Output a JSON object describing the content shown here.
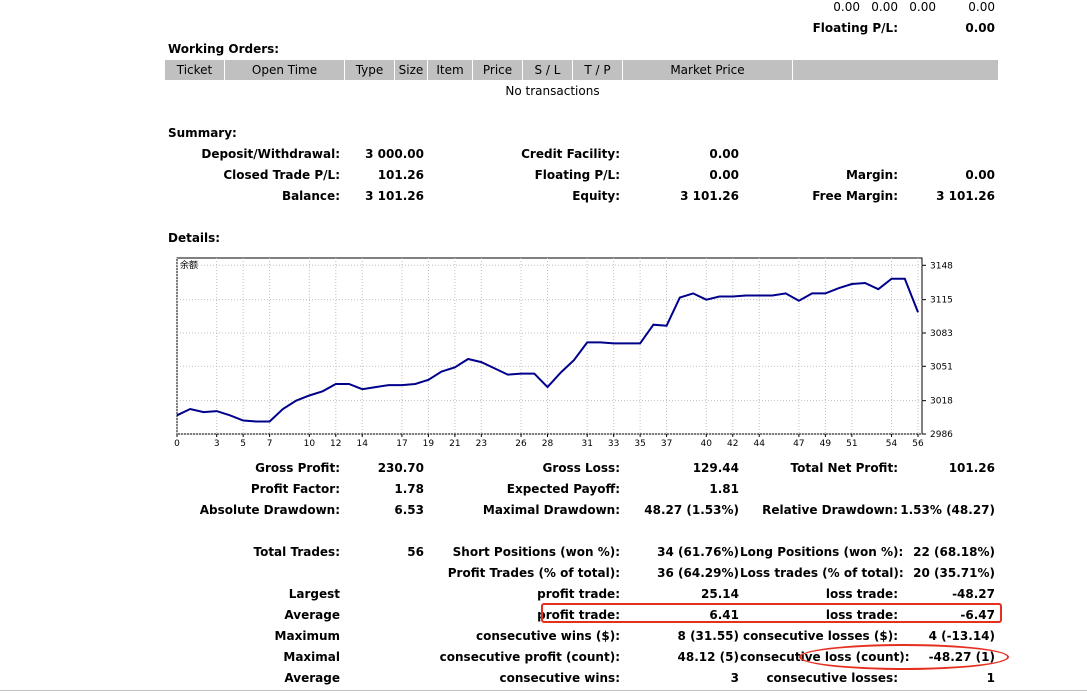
{
  "top": {
    "values": [
      "0.00",
      "0.00",
      "0.00",
      "0.00"
    ],
    "floating_label": "Floating P/L:",
    "floating_value": "0.00"
  },
  "working_orders": {
    "title": "Working Orders:",
    "columns": [
      "Ticket",
      "Open Time",
      "Type",
      "Size",
      "Item",
      "Price",
      "S / L",
      "T / P",
      "Market Price"
    ],
    "empty_text": "No transactions"
  },
  "summary": {
    "title": "Summary:",
    "deposit_label": "Deposit/Withdrawal:",
    "deposit_value": "3 000.00",
    "credit_label": "Credit Facility:",
    "credit_value": "0.00",
    "closed_label": "Closed Trade P/L:",
    "closed_value": "101.26",
    "floating_label": "Floating P/L:",
    "floating_value": "0.00",
    "margin_label": "Margin:",
    "margin_value": "0.00",
    "balance_label": "Balance:",
    "balance_value": "3 101.26",
    "equity_label": "Equity:",
    "equity_value": "3 101.26",
    "free_margin_label": "Free Margin:",
    "free_margin_value": "3 101.26"
  },
  "details": {
    "title": "Details:",
    "gross_profit_label": "Gross Profit:",
    "gross_profit_value": "230.70",
    "gross_loss_label": "Gross Loss:",
    "gross_loss_value": "129.44",
    "total_net_label": "Total Net Profit:",
    "total_net_value": "101.26",
    "profit_factor_label": "Profit Factor:",
    "profit_factor_value": "1.78",
    "expected_payoff_label": "Expected Payoff:",
    "expected_payoff_value": "1.81",
    "abs_dd_label": "Absolute Drawdown:",
    "abs_dd_value": "6.53",
    "max_dd_label": "Maximal Drawdown:",
    "max_dd_value": "48.27 (1.53%)",
    "rel_dd_label": "Relative Drawdown:",
    "rel_dd_value": "1.53% (48.27)",
    "total_trades_label": "Total Trades:",
    "total_trades_value": "56",
    "short_label": "Short Positions (won %):",
    "short_value": "34 (61.76%)",
    "long_label": "Long Positions (won %):",
    "long_value": "22 (68.18%)",
    "profit_trades_label": "Profit Trades (% of total):",
    "profit_trades_value": "36 (64.29%)",
    "loss_trades_label": "Loss trades (% of total):",
    "loss_trades_value": "20 (35.71%)",
    "largest_label": "Largest",
    "largest_profit_label": "profit trade:",
    "largest_profit_value": "25.14",
    "largest_loss_label": "loss trade:",
    "largest_loss_value": "-48.27",
    "average_label": "Average",
    "avg_profit_label": "profit trade:",
    "avg_profit_value": "6.41",
    "avg_loss_label": "loss trade:",
    "avg_loss_value": "-6.47",
    "maximum_label": "Maximum",
    "max_cons_wins_label": "consecutive wins ($):",
    "max_cons_wins_value": "8 (31.55)",
    "max_cons_losses_label": "consecutive losses ($):",
    "max_cons_losses_value": "4 (-13.14)",
    "maximal_label": "Maximal",
    "maximal_profit_label": "consecutive profit (count):",
    "maximal_profit_value": "48.12 (5)",
    "maximal_loss_label": "consecutive loss (count):",
    "maximal_loss_value": "-48.27 (1)",
    "average2_label": "Average",
    "avg_cons_wins_label": "consecutive wins:",
    "avg_cons_wins_value": "3",
    "avg_cons_losses_label": "consecutive losses:",
    "avg_cons_losses_value": "1"
  },
  "chart_data": {
    "type": "line",
    "title": "余额",
    "x": [
      0,
      1,
      2,
      3,
      4,
      5,
      6,
      7,
      8,
      9,
      10,
      11,
      12,
      13,
      14,
      15,
      16,
      17,
      18,
      19,
      20,
      21,
      22,
      23,
      24,
      25,
      26,
      27,
      28,
      29,
      30,
      31,
      32,
      33,
      34,
      35,
      36,
      37,
      38,
      39,
      40,
      41,
      42,
      43,
      44,
      45,
      46,
      47,
      48,
      49,
      50,
      51,
      52,
      53,
      54,
      55,
      56
    ],
    "values": [
      3004,
      3010,
      3007,
      3008,
      3004,
      2999,
      2998,
      2998,
      3010,
      3018,
      3023,
      3027,
      3034,
      3034,
      3029,
      3031,
      3033,
      3033,
      3034,
      3038,
      3046,
      3050,
      3058,
      3055,
      3049,
      3043,
      3044,
      3044,
      3031,
      3045,
      3057,
      3074,
      3074,
      3073,
      3073,
      3073,
      3091,
      3090,
      3117,
      3121,
      3115,
      3118,
      3118,
      3119,
      3119,
      3119,
      3121,
      3114,
      3121,
      3121,
      3126,
      3130,
      3131,
      3125,
      3135,
      3135,
      3103
    ],
    "xticks": [
      0,
      3,
      5,
      7,
      10,
      12,
      14,
      17,
      19,
      21,
      23,
      26,
      28,
      31,
      33,
      35,
      37,
      40,
      42,
      44,
      47,
      49,
      51,
      54,
      56
    ],
    "yticks": [
      2986,
      3018,
      3051,
      3083,
      3115,
      3148
    ],
    "xlim": [
      0,
      56
    ],
    "ylim": [
      2986,
      3155
    ],
    "line_color": "#00008b",
    "grid": true
  }
}
